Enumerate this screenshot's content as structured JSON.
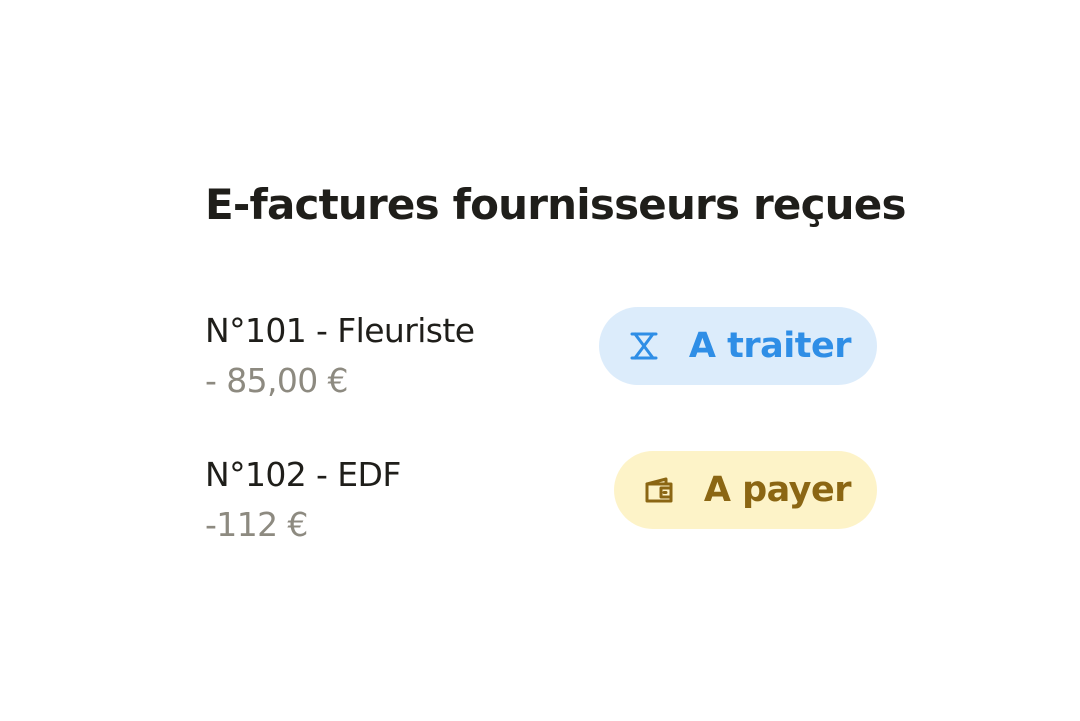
{
  "title": "E-factures fournisseurs reçues",
  "invoices": [
    {
      "name": "N°101 - Fleuriste",
      "amount": "- 85,00 €",
      "status": {
        "label": "A traiter",
        "icon": "hourglass-icon",
        "text_color": "#2f8ee6",
        "background": "#dcecfb"
      }
    },
    {
      "name": "N°102 - EDF",
      "amount": "-112 €",
      "status": {
        "label": "A payer",
        "icon": "wallet-icon",
        "text_color": "#8b6613",
        "background": "#fdf3c8"
      }
    }
  ],
  "colors": {
    "text_primary": "#1f1e1a",
    "text_secondary": "#8d8a80",
    "background": "#ffffff"
  }
}
